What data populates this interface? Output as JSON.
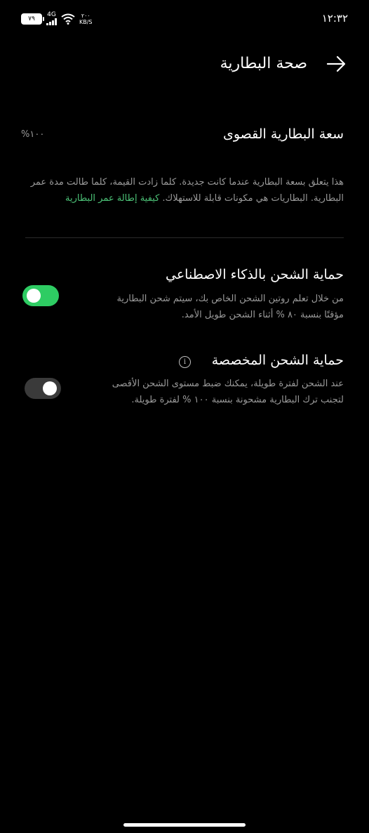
{
  "status_bar": {
    "time": "١٢:٣٢",
    "battery": "٧٩",
    "network": "4G",
    "speed_value": "٢٠٠",
    "speed_unit": "KB/S"
  },
  "header": {
    "title": "صحة البطارية"
  },
  "capacity": {
    "label": "سعة البطارية القصوى",
    "value": "%١٠٠"
  },
  "description": {
    "text": "هذا يتعلق بسعة البطارية عندما كانت جديدة. كلما زادت القيمة، كلما طالت مدة عمر البطارية. البطاريات هي مكونات قابلة للاستهلاك. ",
    "link": "كيفية إطالة عمر البطارية"
  },
  "options": [
    {
      "title": "حماية الشحن بالذكاء الاصطناعي",
      "description": "من خلال تعلم روتين الشحن الخاص بك، سيتم شحن البطارية مؤقتًا بنسبة ٨٠ % أثناء الشحن طويل الأمد.",
      "enabled": true
    },
    {
      "title": "حماية الشحن المخصصة",
      "description": "عند الشحن لفترة طويلة، يمكنك ضبط مستوى الشحن الأقصى لتجنب ترك البطارية مشحونة بنسبة ١٠٠ % لفترة طويلة.",
      "enabled": false
    }
  ],
  "colors": {
    "accent": "#2ecc63",
    "link": "#4cc277",
    "background": "#000000",
    "secondary_text": "#9a9a9a"
  }
}
